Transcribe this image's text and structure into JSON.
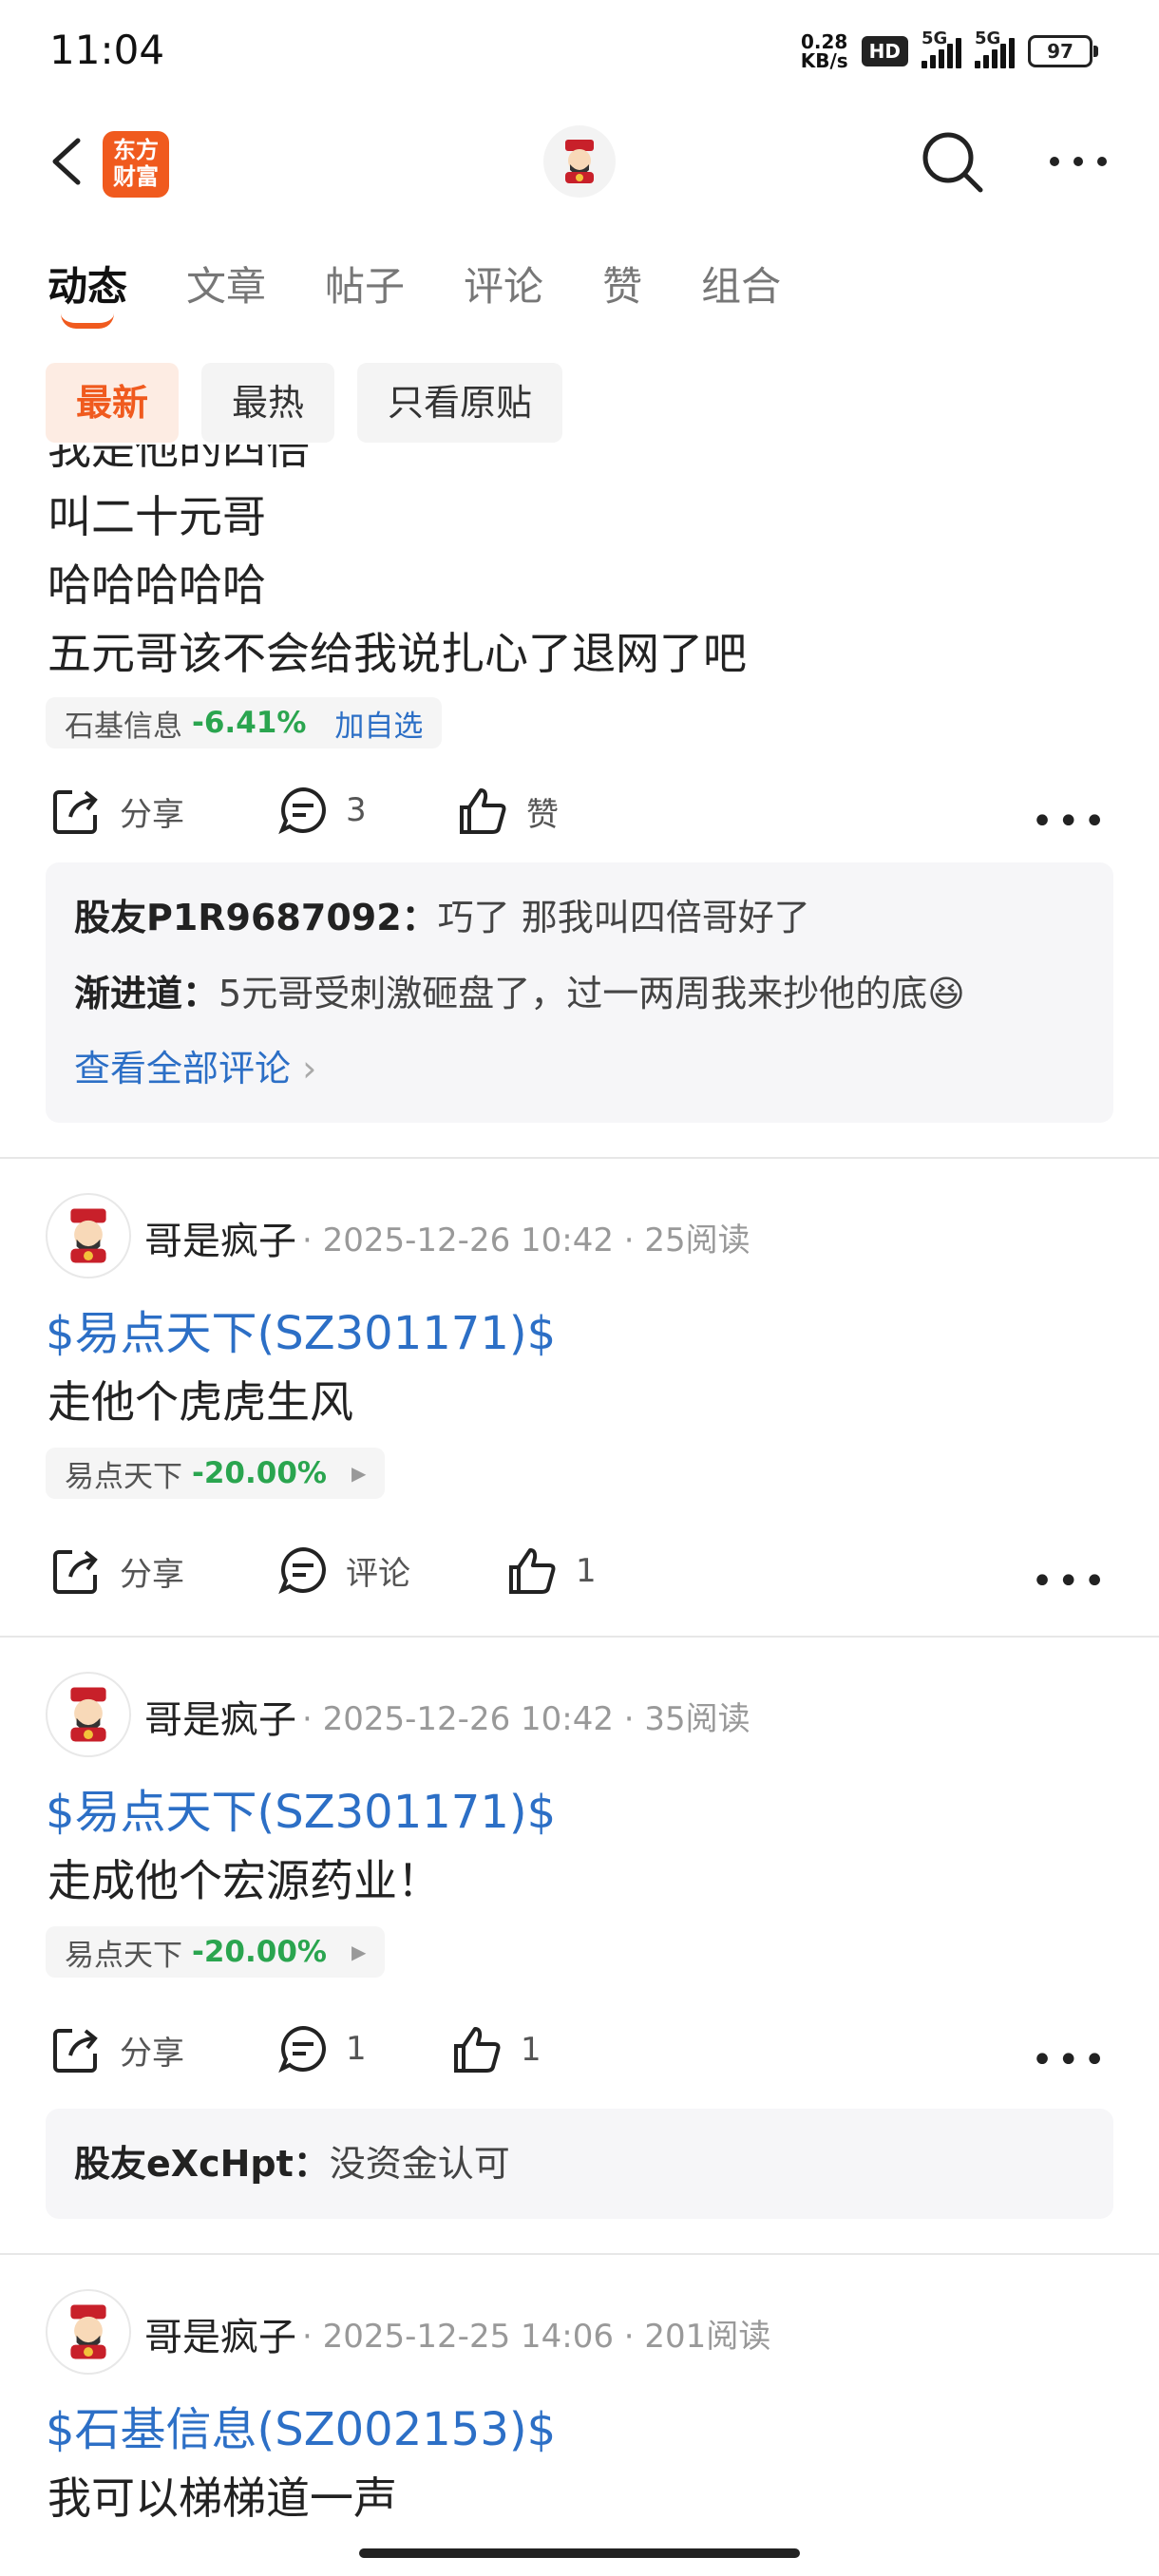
{
  "status_bar": {
    "time": "11:04",
    "net_speed_value": "0.28",
    "net_speed_unit": "KB/s",
    "hd": "HD",
    "sig1": "5G",
    "sig2": "5G",
    "battery": "97"
  },
  "nav": {
    "logo_line1": "东方",
    "logo_line2": "财富"
  },
  "tabs": [
    "动态",
    "文章",
    "帖子",
    "评论",
    "赞",
    "组合"
  ],
  "filters": [
    "最新",
    "最热",
    "只看原贴"
  ],
  "post1": {
    "lines": [
      "我是他的四倍",
      "叫二十元哥",
      "哈哈哈哈哈",
      "五元哥该不会给我说扎心了退网了吧"
    ],
    "stock": {
      "name": "石基信息",
      "change": "-6.41%",
      "add": "加自选"
    },
    "share": "分享",
    "comment_count": "3",
    "like": "赞",
    "comments": [
      {
        "user": "股友P1R9687092",
        "text": "巧了 那我叫四倍哥好了"
      },
      {
        "user": "渐进道",
        "text": "5元哥受刺激砸盘了，过一两周我来抄他的底😆"
      }
    ],
    "view_all": "查看全部评论"
  },
  "post2": {
    "author": "哥是疯子",
    "meta": "· 2025-12-26 10:42 · 25阅读",
    "stock_link": "$易点天下(SZ301171)$",
    "text": "走他个虎虎生风",
    "stock": {
      "name": "易点天下",
      "change": "-20.00%"
    },
    "share": "分享",
    "comment": "评论",
    "like_count": "1"
  },
  "post3": {
    "author": "哥是疯子",
    "meta": "· 2025-12-26 10:42 · 35阅读",
    "stock_link": "$易点天下(SZ301171)$",
    "text": "走成他个宏源药业！",
    "stock": {
      "name": "易点天下",
      "change": "-20.00%"
    },
    "share": "分享",
    "comment_count": "1",
    "like_count": "1",
    "comments": [
      {
        "user": "股友eXcHpt",
        "text": "没资金认可"
      }
    ]
  },
  "post4": {
    "author": "哥是疯子",
    "meta": "· 2025-12-25 14:06 · 201阅读",
    "stock_link": "$石基信息(SZ002153)$",
    "text": "我可以梯梯道一声"
  },
  "colors": {
    "accent": "#f05a1e",
    "link": "#2c6fc6",
    "down": "#2aa54f"
  }
}
